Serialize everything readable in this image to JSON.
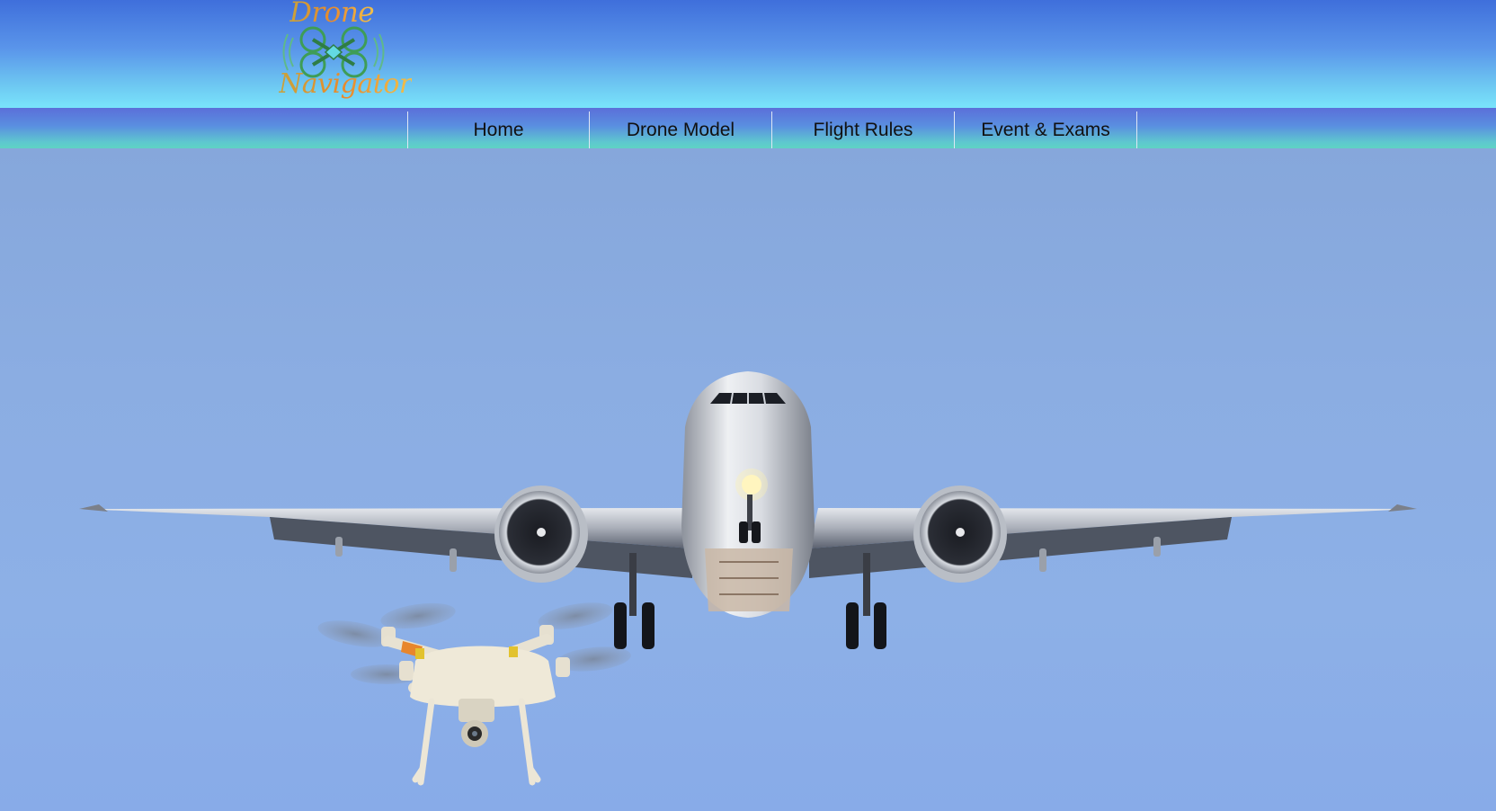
{
  "site": {
    "logo": {
      "line1": "Drone",
      "line2": "Navigator",
      "icon": "quadcopter-logo-icon"
    }
  },
  "nav": {
    "items": [
      {
        "label": "Home"
      },
      {
        "label": "Drone Model"
      },
      {
        "label": "Flight Rules"
      },
      {
        "label": "Event & Exams"
      }
    ]
  },
  "hero": {
    "image": "airplane-and-drone-photo",
    "colors": {
      "sky": "#8db0e7",
      "header_top": "#3f6fdb",
      "header_bottom": "#79e4fb",
      "nav_accent": "#5fd3c3"
    }
  }
}
